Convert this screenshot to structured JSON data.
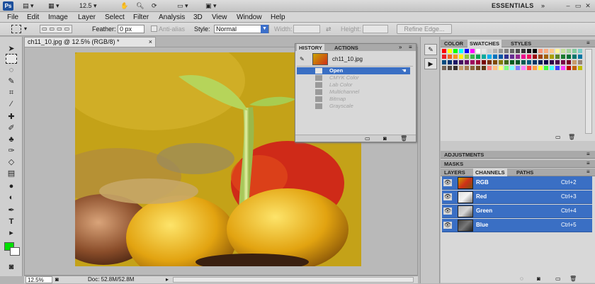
{
  "appbar": {
    "logo": "Ps",
    "zoom_value": "12.5",
    "workspace": "ESSENTIALS",
    "controls": [
      "–",
      "▭",
      "✕"
    ]
  },
  "menubar": [
    "File",
    "Edit",
    "Image",
    "Layer",
    "Select",
    "Filter",
    "Analysis",
    "3D",
    "View",
    "Window",
    "Help"
  ],
  "options": {
    "feather_label": "Feather:",
    "feather_value": "0 px",
    "antialias_label": "Anti-alias",
    "style_label": "Style:",
    "style_value": "Normal",
    "width_label": "Width:",
    "height_label": "Height:",
    "refine_label": "Refine Edge..."
  },
  "document": {
    "tab_title": "ch11_10.jpg @ 12.5% (RGB/8) *",
    "close": "×",
    "zoom_status": "12.5%",
    "doc_status": "Doc: 52.8M/52.8M"
  },
  "history": {
    "tabs": [
      "HISTORY",
      "ACTIONS"
    ],
    "snapshot": "ch11_10.jpg",
    "items": [
      {
        "label": "Open",
        "active": true
      },
      {
        "label": "CMYK Color",
        "active": false
      },
      {
        "label": "Lab Color",
        "active": false
      },
      {
        "label": "Multichannel",
        "active": false
      },
      {
        "label": "Bitmap",
        "active": false
      },
      {
        "label": "Grayscale",
        "active": false
      }
    ]
  },
  "panels": {
    "color_tabs": [
      "COLOR",
      "SWATCHES",
      "STYLES"
    ],
    "adjustments": "ADJUSTMENTS",
    "masks": "MASKS",
    "layer_tabs": [
      "LAYERS",
      "CHANNELS",
      "PATHS"
    ],
    "channels": [
      {
        "name": "RGB",
        "shortcut": "Ctrl+2"
      },
      {
        "name": "Red",
        "shortcut": "Ctrl+3"
      },
      {
        "name": "Green",
        "shortcut": "Ctrl+4"
      },
      {
        "name": "Blue",
        "shortcut": "Ctrl+5"
      }
    ]
  },
  "colors": {
    "foreground": "#00e000",
    "background": "#ffffff",
    "selection_blue": "#3a6fc4"
  }
}
